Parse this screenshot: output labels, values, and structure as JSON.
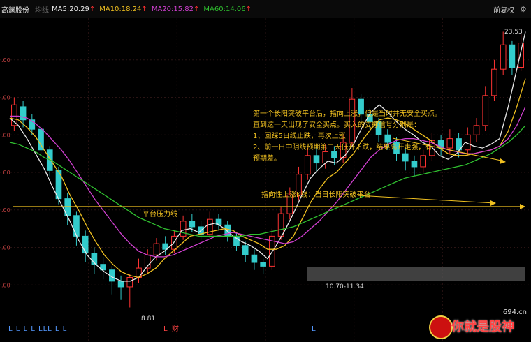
{
  "header": {
    "stock_name": "高澜股份",
    "line_type": "均线",
    "ma5": "MA5:20.29",
    "ma10": "MA10:18.24",
    "ma20": "MA20:15.82",
    "ma60": "MA60:14.06",
    "up_arrow": "↑",
    "adjust_label": "前复权",
    "settings_icon": "gear-icon"
  },
  "annotations": {
    "note_lines": [
      "第一个长阳突破平台后，指向上涨，但是当时并无安全买点。",
      "直到这一天出现了安全买点。买入的支撑信号分别是：",
      "1、回踩5日线止跌，再次上涨",
      "2、前一日中阴线预期第二天低开下跌，结果高开走强，有",
      "预期差。"
    ],
    "breakout_label": "指向性上涨K线：当日长阳突破平台",
    "platform_label": "平台压力线",
    "high_label": "23.53",
    "low_label": "8.81",
    "range_label": "10.70-11.34"
  },
  "markers": {
    "left_L_group": "L  L L L  LLL L  L",
    "mid_L": "L",
    "cai": "财",
    "right_L": "L"
  },
  "watermark": {
    "domain": "694.cn",
    "brand": "你就是股神"
  },
  "colors": {
    "up": "#ff3333",
    "down": "#33cccc",
    "ma5": "#e8e8e8",
    "ma10": "#f0c020",
    "ma20": "#d040d0",
    "ma60": "#30c030",
    "annotation": "#f0c020"
  },
  "chart_data": {
    "type": "candlestick",
    "title": "",
    "series": [
      {
        "name": "MA5",
        "values": [
          18.9,
          18.5,
          17.8,
          17.0,
          16.2,
          15.2,
          14.3,
          13.4,
          12.4,
          11.6,
          11.1,
          10.7,
          10.4,
          10.2,
          10.2,
          10.4,
          11.0,
          11.5,
          11.8,
          12.2,
          12.9,
          13.0,
          12.8,
          13.2,
          13.3,
          13.0,
          12.6,
          12.3,
          12.1,
          11.8,
          11.4,
          12.1,
          12.9,
          13.8,
          14.8,
          15.7,
          16.2,
          16.6,
          16.5,
          16.9,
          17.5,
          18.4,
          19.2,
          19.6,
          19.2,
          18.7,
          18.3,
          18.0,
          17.6,
          17.4,
          16.9,
          16.7,
          17.0,
          17.6,
          17.4,
          17.3,
          17.5,
          17.8,
          19.5,
          21.5,
          23.5
        ]
      },
      {
        "name": "MA10",
        "values": [
          18.9,
          18.8,
          18.4,
          17.9,
          17.2,
          16.5,
          15.8,
          14.8,
          14.0,
          13.1,
          12.3,
          11.6,
          11.1,
          10.7,
          10.5,
          10.4,
          10.6,
          10.9,
          11.4,
          11.8,
          12.2,
          12.6,
          12.7,
          12.8,
          12.9,
          13.0,
          12.9,
          12.6,
          12.4,
          12.2,
          11.9,
          11.9,
          12.1,
          12.6,
          13.5,
          14.4,
          15.1,
          15.7,
          16.0,
          16.5,
          17.0,
          17.7,
          18.3,
          18.8,
          18.9,
          18.8,
          18.6,
          18.3,
          18.0,
          17.7,
          17.3,
          17.0,
          16.9,
          16.9,
          17.0,
          17.1,
          17.2,
          17.4,
          18.2,
          19.5,
          21.0
        ]
      },
      {
        "name": "MA20",
        "values": [
          19.0,
          19.0,
          18.9,
          18.6,
          18.2,
          17.7,
          17.2,
          16.6,
          15.9,
          15.2,
          14.5,
          13.9,
          13.3,
          12.7,
          12.2,
          11.8,
          11.6,
          11.5,
          11.5,
          11.6,
          11.8,
          12.0,
          12.2,
          12.4,
          12.6,
          12.7,
          12.8,
          12.7,
          12.6,
          12.5,
          12.4,
          12.3,
          12.2,
          12.3,
          12.6,
          13.0,
          13.4,
          13.9,
          14.4,
          15.0,
          15.6,
          16.2,
          16.8,
          17.2,
          17.5,
          17.7,
          17.8,
          17.8,
          17.7,
          17.6,
          17.4,
          17.2,
          17.1,
          17.0,
          17.0,
          17.1,
          17.2,
          17.4,
          17.8,
          18.5,
          19.5
        ]
      },
      {
        "name": "MA60",
        "values": [
          17.6,
          17.5,
          17.3,
          17.1,
          16.8,
          16.6,
          16.3,
          16.0,
          15.7,
          15.4,
          15.1,
          14.8,
          14.5,
          14.2,
          13.9,
          13.6,
          13.4,
          13.2,
          13.0,
          12.9,
          12.8,
          12.7,
          12.6,
          12.6,
          12.6,
          12.6,
          12.6,
          12.6,
          12.7,
          12.7,
          12.8,
          12.9,
          13.0,
          13.1,
          13.3,
          13.5,
          13.7,
          13.9,
          14.1,
          14.3,
          14.5,
          14.7,
          14.9,
          15.1,
          15.3,
          15.5,
          15.7,
          15.8,
          15.9,
          16.0,
          16.1,
          16.2,
          16.3,
          16.4,
          16.6,
          16.8,
          17.0,
          17.3,
          17.6,
          18.0,
          18.5
        ]
      }
    ],
    "candles": [
      [
        18.5,
        19.6,
        18.2,
        20.0
      ],
      [
        19.5,
        18.8,
        18.4,
        19.8
      ],
      [
        18.8,
        18.3,
        18.0,
        19.1
      ],
      [
        18.3,
        17.2,
        16.9,
        18.5
      ],
      [
        17.2,
        16.1,
        15.8,
        17.4
      ],
      [
        16.1,
        14.6,
        14.3,
        16.3
      ],
      [
        14.6,
        13.7,
        13.2,
        14.9
      ],
      [
        13.7,
        12.6,
        12.1,
        13.9
      ],
      [
        12.6,
        11.7,
        11.2,
        12.9
      ],
      [
        11.7,
        11.1,
        10.6,
        12.0
      ],
      [
        11.1,
        10.8,
        10.3,
        11.5
      ],
      [
        10.8,
        10.2,
        9.5,
        11.0
      ],
      [
        10.2,
        9.9,
        9.2,
        10.5
      ],
      [
        9.9,
        10.4,
        8.8,
        10.6
      ],
      [
        10.4,
        10.9,
        10.1,
        11.4
      ],
      [
        10.9,
        11.6,
        10.6,
        11.9
      ],
      [
        11.6,
        12.2,
        11.3,
        12.5
      ],
      [
        12.2,
        11.9,
        11.6,
        12.6
      ],
      [
        11.9,
        12.6,
        11.7,
        12.9
      ],
      [
        12.6,
        13.4,
        12.4,
        13.7
      ],
      [
        13.4,
        13.1,
        12.8,
        13.8
      ],
      [
        13.1,
        12.7,
        12.4,
        13.4
      ],
      [
        12.7,
        13.5,
        12.5,
        13.9
      ],
      [
        13.5,
        13.2,
        12.9,
        13.8
      ],
      [
        13.2,
        12.6,
        12.3,
        13.4
      ],
      [
        12.6,
        12.1,
        11.8,
        12.8
      ],
      [
        12.1,
        11.6,
        11.2,
        12.3
      ],
      [
        11.6,
        11.2,
        10.8,
        11.9
      ],
      [
        11.2,
        11.0,
        10.6,
        11.4
      ],
      [
        11.0,
        12.6,
        10.8,
        13.0
      ],
      [
        12.6,
        13.8,
        12.4,
        14.2
      ],
      [
        13.8,
        14.8,
        13.5,
        15.2
      ],
      [
        14.8,
        15.9,
        14.5,
        16.3
      ],
      [
        15.9,
        16.9,
        15.6,
        17.3
      ],
      [
        16.9,
        16.5,
        16.0,
        17.4
      ],
      [
        16.5,
        17.1,
        16.2,
        17.5
      ],
      [
        17.1,
        16.8,
        16.4,
        17.4
      ],
      [
        16.8,
        17.6,
        16.5,
        18.0
      ],
      [
        17.6,
        19.9,
        17.4,
        20.5
      ],
      [
        19.9,
        19.1,
        18.6,
        20.2
      ],
      [
        19.1,
        18.7,
        18.3,
        19.4
      ],
      [
        18.7,
        18.0,
        17.6,
        18.9
      ],
      [
        18.0,
        17.6,
        17.2,
        18.3
      ],
      [
        17.6,
        17.0,
        16.6,
        17.9
      ],
      [
        17.0,
        16.6,
        16.1,
        17.3
      ],
      [
        16.6,
        16.3,
        15.8,
        16.9
      ],
      [
        16.3,
        16.9,
        16.0,
        17.2
      ],
      [
        16.9,
        17.7,
        16.6,
        18.1
      ],
      [
        17.7,
        17.3,
        16.9,
        18.0
      ],
      [
        17.3,
        17.8,
        17.0,
        18.3
      ],
      [
        17.8,
        17.2,
        16.8,
        18.1
      ],
      [
        17.2,
        18.0,
        16.9,
        18.4
      ],
      [
        18.0,
        18.5,
        17.6,
        18.9
      ],
      [
        18.5,
        20.1,
        18.2,
        20.6
      ],
      [
        20.1,
        21.5,
        19.8,
        22.0
      ],
      [
        21.5,
        22.8,
        21.2,
        23.5
      ],
      [
        22.8,
        21.6,
        21.2,
        23.0
      ],
      [
        21.6,
        22.9,
        21.4,
        23.4
      ]
    ],
    "annotated_values": {
      "high": 23.53,
      "low": 8.81,
      "range": "10.70-11.34"
    },
    "ylim": [
      8,
      24
    ],
    "grid": true,
    "legend": "top"
  }
}
